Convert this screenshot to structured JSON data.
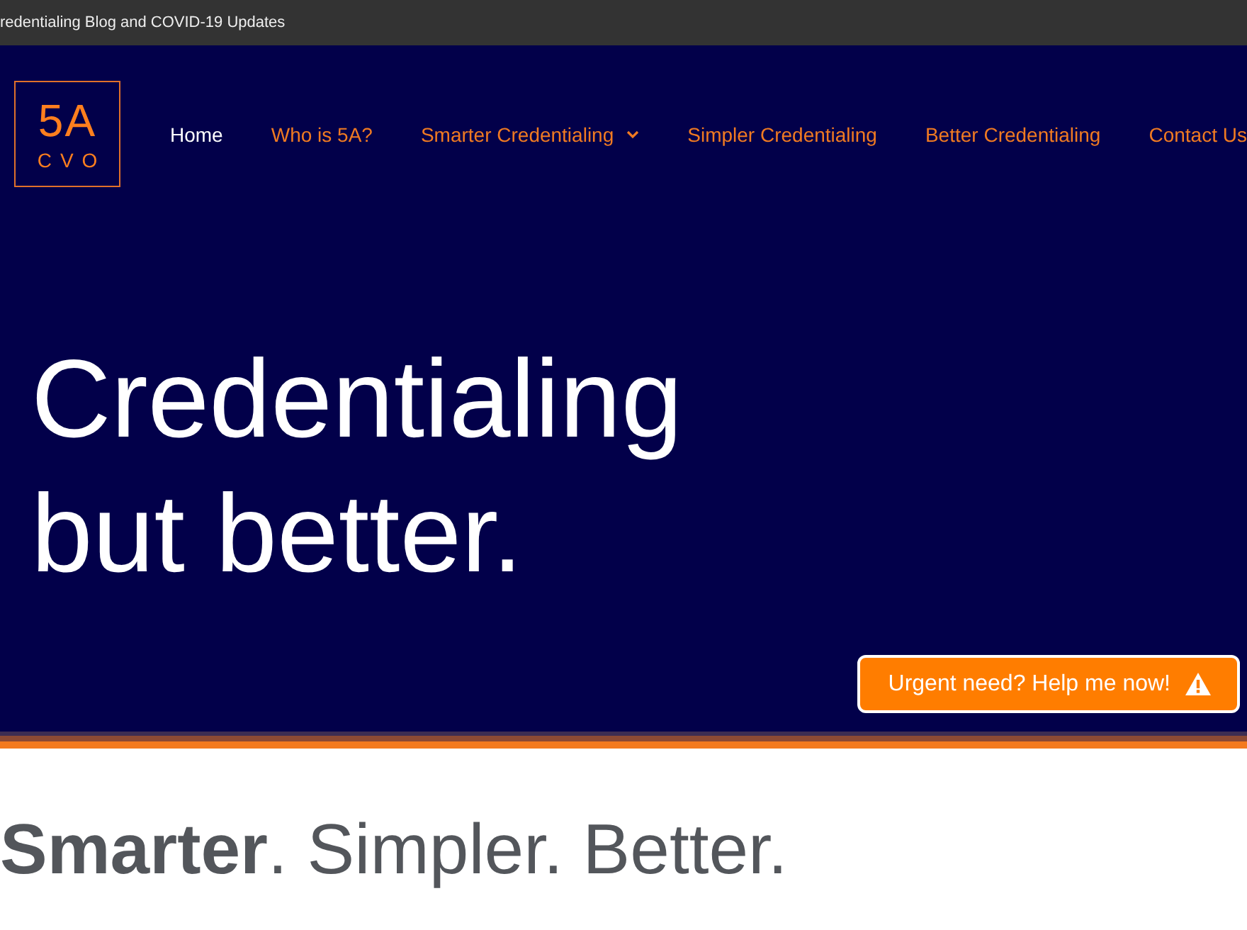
{
  "top_bar": {
    "text": "redentialing Blog and COVID-19 Updates"
  },
  "header": {
    "logo": {
      "mark": "5A",
      "subtitle": "CVO"
    },
    "nav": [
      {
        "label": "Home",
        "selected": true,
        "has_dropdown": false
      },
      {
        "label": "Who is 5A?",
        "selected": false,
        "has_dropdown": false
      },
      {
        "label": "Smarter Credentialing",
        "selected": false,
        "has_dropdown": true
      },
      {
        "label": "Simpler Credentialing",
        "selected": false,
        "has_dropdown": false
      },
      {
        "label": "Better Credentialing",
        "selected": false,
        "has_dropdown": false
      },
      {
        "label": "Contact Us",
        "selected": false,
        "has_dropdown": false
      }
    ]
  },
  "hero": {
    "heading_lines": [
      "Credentialing",
      "but better."
    ],
    "urgent_button": {
      "label": "Urgent need? Help me now!"
    }
  },
  "tagline": "**Smarter**. Simpler. Better."
}
